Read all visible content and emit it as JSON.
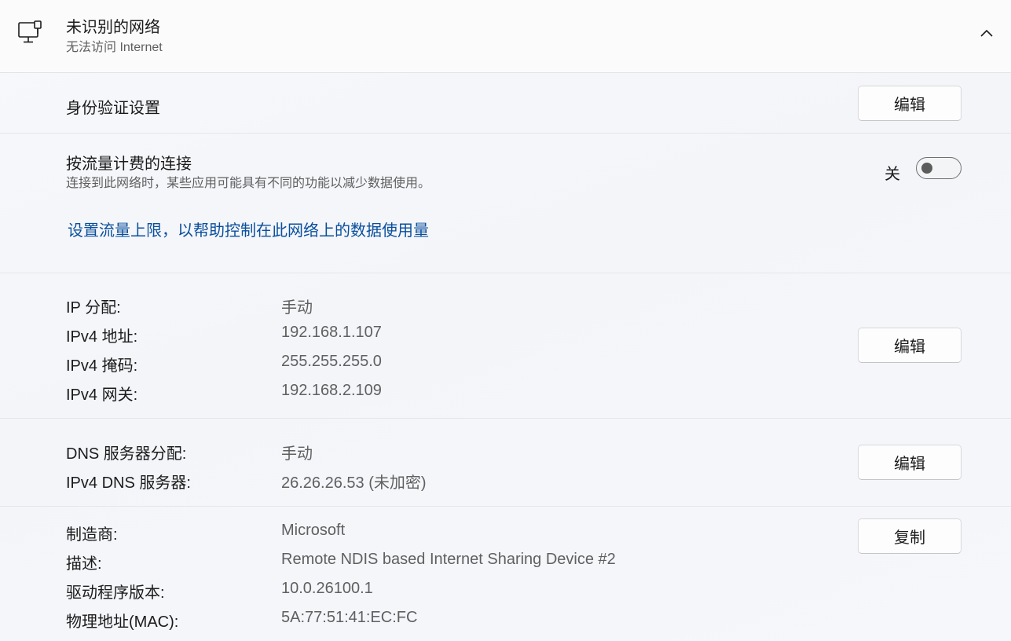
{
  "header": {
    "title": "未识别的网络",
    "subtitle": "无法访问 Internet",
    "icon": "network-computer-icon",
    "collapse_icon": "chevron-up-icon"
  },
  "auth": {
    "label": "身份验证设置",
    "edit_label": "编辑"
  },
  "metered": {
    "title": "按流量计费的连接",
    "description": "连接到此网络时，某些应用可能具有不同的功能以减少数据使用。",
    "toggle_state_label": "关",
    "toggle_on": false,
    "link": "设置流量上限，以帮助控制在此网络上的数据使用量"
  },
  "ip": {
    "rows": [
      {
        "label": "IP 分配:",
        "value": "手动"
      },
      {
        "label": "IPv4 地址:",
        "value": "192.168.1.107"
      },
      {
        "label": "IPv4 掩码:",
        "value": "255.255.255.0"
      },
      {
        "label": "IPv4 网关:",
        "value": "192.168.2.109"
      }
    ],
    "edit_label": "编辑"
  },
  "dns": {
    "rows": [
      {
        "label": "DNS 服务器分配:",
        "value": "手动"
      },
      {
        "label": "IPv4 DNS 服务器:",
        "value": "26.26.26.53 (未加密)"
      }
    ],
    "edit_label": "编辑"
  },
  "hardware": {
    "rows": [
      {
        "label": "制造商:",
        "value": "Microsoft"
      },
      {
        "label": "描述:",
        "value": "Remote NDIS based Internet Sharing Device #2"
      },
      {
        "label": "驱动程序版本:",
        "value": "10.0.26100.1"
      },
      {
        "label": "物理地址(MAC):",
        "value": "5A:77:51:41:EC:FC"
      }
    ],
    "copy_label": "复制"
  },
  "colors": {
    "link": "#0a4f9c",
    "text": "#1b1b1b",
    "secondary_text": "#606060",
    "toggle_off": "#5c5c5c"
  }
}
